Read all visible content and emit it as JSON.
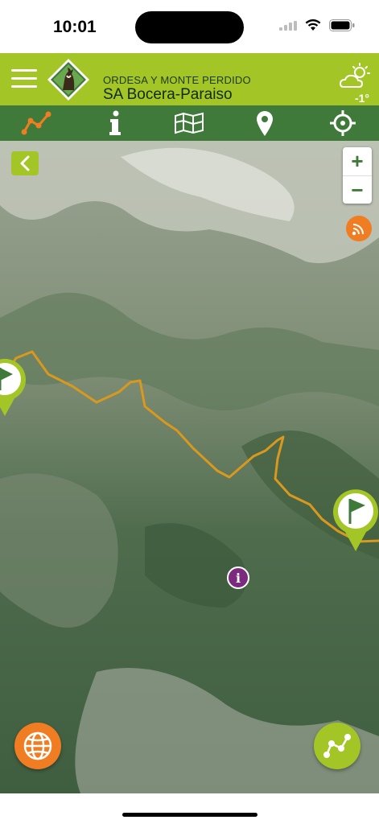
{
  "status_bar": {
    "time": "10:01"
  },
  "header": {
    "park_name": "ORDESA Y MONTE PERDIDO",
    "route_name": "SA Bocera-Paraiso",
    "weather_icon": "partly-cloudy-icon",
    "temperature": "-1°"
  },
  "toolbar": {
    "items": [
      {
        "name": "route-icon"
      },
      {
        "name": "info-icon"
      },
      {
        "name": "map-layers-icon"
      },
      {
        "name": "location-pin-icon"
      },
      {
        "name": "crosshair-icon"
      }
    ]
  },
  "map": {
    "zoom_in": "+",
    "zoom_out": "−",
    "info_poi": "i"
  },
  "colors": {
    "brand_green": "#a3c626",
    "toolbar_green": "#3f7a3a",
    "accent_orange": "#f07d22",
    "route_line": "#d9981e",
    "poi_purple": "#7b2a7e"
  }
}
